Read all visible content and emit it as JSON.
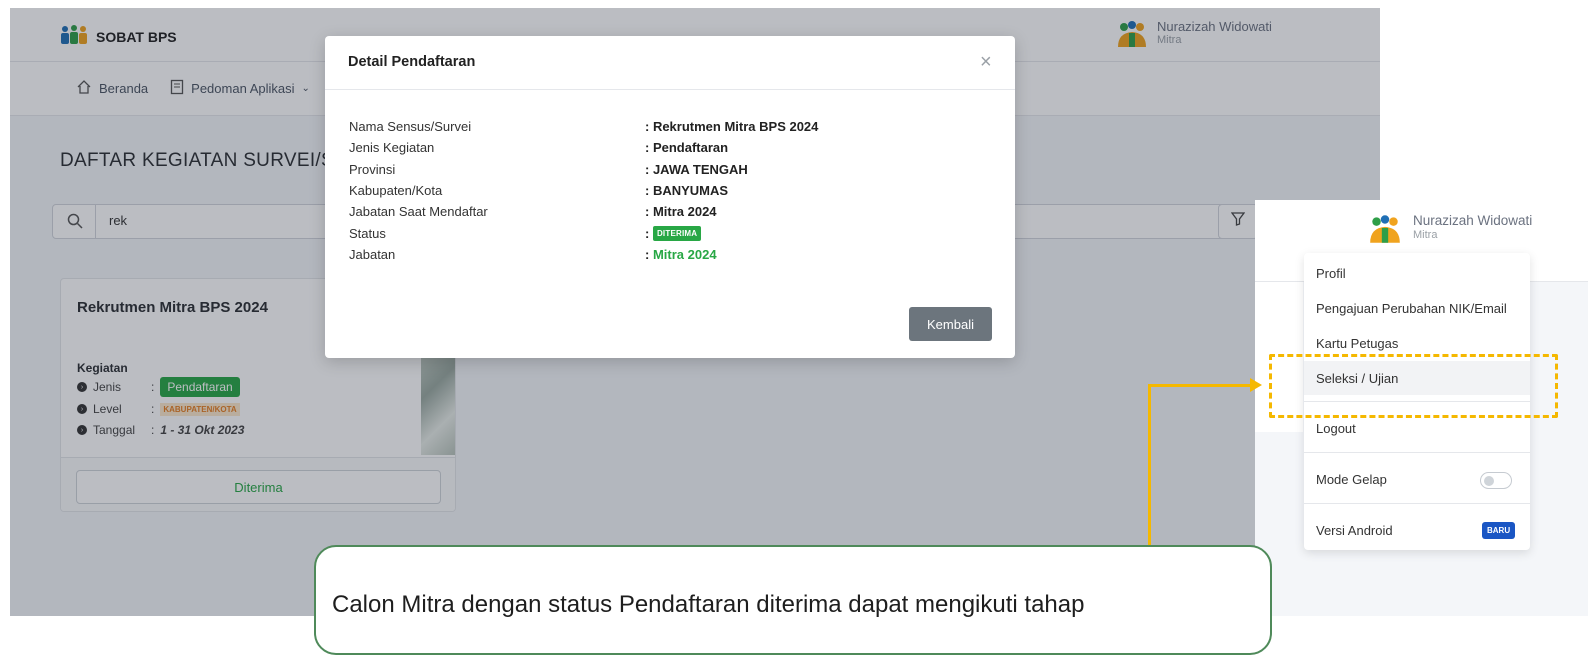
{
  "app": {
    "brand": "SOBAT BPS",
    "user": {
      "name": "Nurazizah Widowati",
      "role": "Mitra"
    },
    "nav": [
      {
        "label": "Beranda",
        "icon": "home-icon"
      },
      {
        "label": "Pedoman Aplikasi",
        "icon": "book-icon"
      }
    ],
    "page_title": "DAFTAR KEGIATAN SURVEI/S",
    "search_value": "rek",
    "card": {
      "title": "Rekrutmen Mitra BPS 2024",
      "section": "Kegiatan",
      "rows": [
        {
          "label": "Jenis",
          "sep": ":",
          "value": "Pendaftaran"
        },
        {
          "label": "Level",
          "sep": ":",
          "value": "KABUPATEN/KOTA"
        },
        {
          "label": "Tanggal",
          "sep": ":",
          "value": "1 - 31 Okt 2023"
        }
      ],
      "button": "Diterima"
    }
  },
  "modal": {
    "title": "Detail Pendaftaran",
    "close_glyph": "×",
    "fields": [
      {
        "label": "Nama Sensus/Survei",
        "value": ": Rekrutmen Mitra BPS 2024"
      },
      {
        "label": "Jenis Kegiatan",
        "value": ": Pendaftaran"
      },
      {
        "label": "Provinsi",
        "value": ": JAWA TENGAH"
      },
      {
        "label": "Kabupaten/Kota",
        "value": ": BANYUMAS"
      },
      {
        "label": "Jabatan Saat Mendaftar",
        "value": ": Mitra 2024"
      },
      {
        "label": "Status",
        "prefix": ": ",
        "badge": "DITERIMA"
      },
      {
        "label": "Jabatan",
        "prefix": ": ",
        "value": "Mitra 2024"
      }
    ],
    "button": "Kembali"
  },
  "dropdown": {
    "user": {
      "name": "Nurazizah Widowati",
      "role": "Mitra"
    },
    "items": [
      "Profil",
      "Pengajuan Perubahan NIK/Email",
      "Kartu Petugas",
      "Seleksi / Ujian",
      "Logout",
      "Mode Gelap",
      "Versi Android"
    ],
    "badge_new": "BARU",
    "dark_mode_on": false
  },
  "callout": {
    "text": "Calon Mitra dengan status Pendaftaran diterima dapat mengikuti tahap"
  },
  "colors": {
    "accent_green": "#28a745",
    "highlight_yellow": "#f5b800",
    "badge_blue": "#1a56c4"
  }
}
